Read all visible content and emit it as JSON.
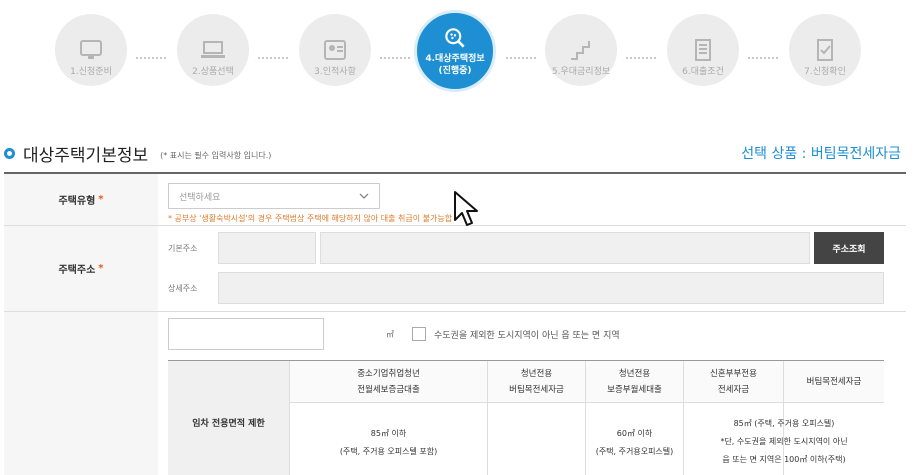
{
  "steps": [
    {
      "label": "1.신청준비",
      "icon": "monitor-icon"
    },
    {
      "label": "2.상품선택",
      "icon": "laptop-icon"
    },
    {
      "label": "3.인적사항",
      "icon": "id-card-icon"
    },
    {
      "label": "4.대상주택정보",
      "sublabel": "(진행중)",
      "icon": "search-house-icon",
      "active": true
    },
    {
      "label": "5.우대금리정보",
      "icon": "stairs-icon"
    },
    {
      "label": "6.대출조건",
      "icon": "document-icon"
    },
    {
      "label": "7.신청확인",
      "icon": "check-doc-icon"
    }
  ],
  "section": {
    "title": "대상주택기본정보",
    "note": "(* 표시는 필수 입력사항 입니다.)",
    "product": "선택 상품 : 버팀목전세자금"
  },
  "house_type": {
    "label": "주택유형",
    "placeholder": "선택하세요",
    "warning": "* 공부상 '생활숙박시설'의 경우 주택법상 주택에 해당하지 않아 대출 취급이 불가능합"
  },
  "address": {
    "label": "주택주소",
    "basic_label": "기본주소",
    "detail_label": "상세주소",
    "search_button": "주소조회"
  },
  "area": {
    "unit": "㎡",
    "checkbox_label": "수도권을 제외한 도시지역이 아닌 읍 또는 면 지역",
    "limit_label": "임차 전용면적 제한",
    "columns": [
      {
        "header1": "중소기업취업청년",
        "header2": "전월세보증금대출",
        "body1": "85㎡ 이하",
        "body2": "(주택, 주거용 오피스텔 포함)"
      },
      {
        "header1": "청년전용",
        "header2": "버팀목전세자금",
        "body1": "",
        "body2": ""
      },
      {
        "header1": "청년전용",
        "header2": "보증부월세대출",
        "body1": "60㎡ 이하",
        "body2": "(주택, 주거용오피스텔)"
      },
      {
        "header1": "신혼부부전용",
        "header2": "전세자금",
        "body1": "85㎡ (주택, 주거용 오피스텔)",
        "body2": "*단, 수도권을 제외한 도시지역이 아닌",
        "body3": "읍 또는 면 지역은 100㎡ 이하(주택)"
      },
      {
        "header1": "버팀목전세자금",
        "header2": "",
        "body1": "",
        "body2": ""
      }
    ]
  },
  "colors": {
    "accent": "#1d8fd2",
    "warning": "#e07a2a",
    "dark_button": "#444444"
  }
}
